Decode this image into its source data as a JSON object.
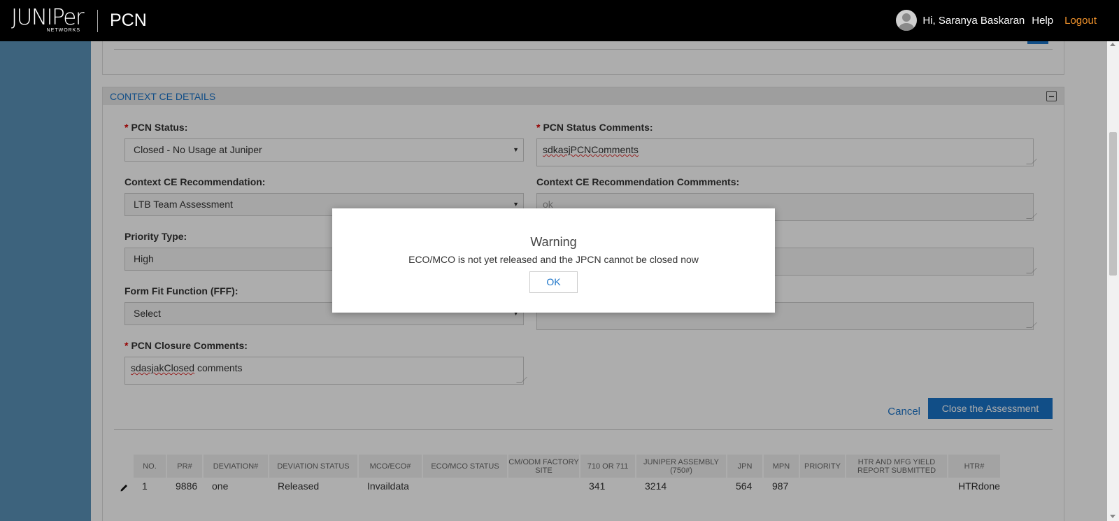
{
  "header": {
    "logo_text": "JUNIPer",
    "logo_sub": "NETWORKS",
    "app_name": "PCN",
    "greeting": "Hi, Saranya Baskaran",
    "help": "Help",
    "logout": "Logout"
  },
  "section": {
    "title": "CONTEXT CE DETAILS"
  },
  "form": {
    "pcn_status_label": "PCN Status:",
    "pcn_status_value": "Closed - No Usage at Juniper",
    "pcn_status_comments_label": "PCN Status Comments:",
    "pcn_status_comments_value": "sdkasjPCNComments",
    "ce_recommendation_label": "Context CE Recommendation:",
    "ce_recommendation_value": "LTB Team Assessment",
    "ce_recommendation_comments_label": "Context CE Recommendation Commments:",
    "ce_recommendation_comments_value": "ok",
    "priority_type_label": "Priority Type:",
    "priority_type_value": "High",
    "fff_label": "Form Fit Function (FFF):",
    "fff_value": "Select",
    "closure_comments_label": "PCN Closure Comments:",
    "closure_comments_word1": "sdasjakClosed",
    "closure_comments_word2": " comments",
    "cancel": "Cancel",
    "close_assessment": "Close the Assessment"
  },
  "table": {
    "columns": [
      "NO.",
      "PR#",
      "DEVIATION#",
      "DEVIATION STATUS",
      "MCO/ECO#",
      "ECO/MCO STATUS",
      "CM/ODM FACTORY SITE",
      "710 OR 711",
      "JUNIPER ASSEMBLY (750#)",
      "JPN",
      "MPN",
      "PRIORITY",
      "HTR AND MFG YIELD REPORT SUBMITTED",
      "HTR#"
    ],
    "rows": [
      [
        "1",
        "9886",
        "one",
        "Released",
        "Invaildata",
        "",
        "",
        "341",
        "3214",
        "564",
        "987",
        "",
        "",
        "HTRdone"
      ]
    ]
  },
  "modal": {
    "title": "Warning",
    "message": "ECO/MCO is not yet released and the JPCN cannot be closed now",
    "ok": "OK"
  },
  "colors": {
    "accent": "#1a73c8",
    "logout": "#f0922b",
    "sidebar": "#5a92b8"
  }
}
